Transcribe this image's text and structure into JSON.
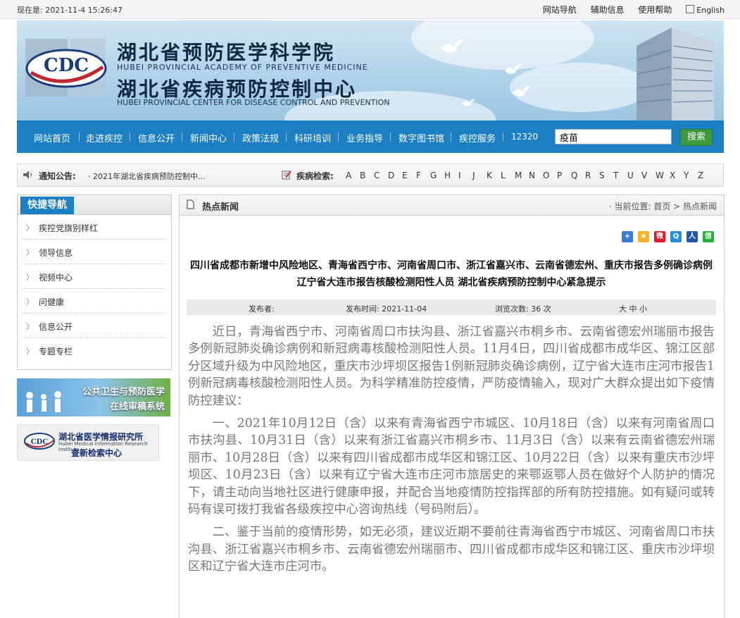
{
  "topbar": {
    "time": "现在是: 2021-11-4 15:26:47",
    "links": [
      "网站导航",
      "辅助信息",
      "使用帮助"
    ],
    "english": "English"
  },
  "banner": {
    "title_line1": "湖北省预防医学科学院",
    "subtitle_line1": "HUBEI PROVINCIAL ACADEMY OF PREVENTIVE MEDICINE",
    "title_line2": "湖北省疾病预防控制中心",
    "subtitle_line2": "HUBEI PROVINCIAL CENTER FOR DISEASE CONTROL AND PREVENTION",
    "logo_text": "CDC"
  },
  "nav": {
    "items": [
      "网站首页",
      "走进疾控",
      "信息公开",
      "新闻中心",
      "政策法规",
      "科研培训",
      "业务指导",
      "数字图书馆",
      "疾控服务",
      "12320"
    ],
    "search_value": "疫苗",
    "search_button": "搜索"
  },
  "notice": {
    "label": "通知公告:",
    "text": "· 2021年湖北省疾病预防控制中...",
    "disease_label": "疾病检索:",
    "letters": [
      "A",
      "B",
      "C",
      "D",
      "E",
      "F",
      "G",
      "H",
      "I",
      "J",
      "K",
      "L",
      "M",
      "N",
      "O",
      "P",
      "Q",
      "R",
      "S",
      "T",
      "U",
      "V",
      "W",
      "X",
      "Y",
      "Z"
    ]
  },
  "sidebar": {
    "title": "快捷导航",
    "items": [
      "疾控党旗别样红",
      "领导信息",
      "视频中心",
      "问健康",
      "信息公开",
      "专题专栏"
    ]
  },
  "promo1": {
    "line1": "公共卫生与预防医学",
    "line2": "在线审稿系统"
  },
  "promo2": {
    "line1": "湖北省医学情报研究所",
    "small": "Hubei Medical Information Research Institute",
    "line2": "查新检索中心"
  },
  "content": {
    "section_title": "热点新闻",
    "breadcrumb": "· 当前位置: 首页 > 热点新闻",
    "article_title": "四川省成都市新增中风险地区、青海省西宁市、河南省周口市、浙江省嘉兴市、云南省德宏州、重庆市报告多例确诊病例  辽宁省大连市报告核酸检测阳性人员  湖北省疾病预防控制中心紧急提示",
    "meta": {
      "publisher": "发布者:",
      "date": "发布时间: 2021-11-04",
      "views": "浏览次数: 36 次",
      "size": "大 中 小"
    },
    "paragraphs": [
      "近日，青海省西宁市、河南省周口市扶沟县、浙江省嘉兴市桐乡市、云南省德宏州瑞丽市报告多例新冠肺炎确诊病例和新冠病毒核酸检测阳性人员。11月4日，四川省成都市成华区、锦江区部分区域升级为中风险地区，重庆市沙坪坝区报告1例新冠肺炎确诊病例，辽宁省大连市庄河市报告1例新冠病毒核酸检测阳性人员。为科学精准防控疫情，严防疫情输入，现对广大群众提出如下疫情防控建议：",
      "一、2021年10月12日（含）以来有青海省西宁市城区、10月18日（含）以来有河南省周口市扶沟县、10月31日（含）以来有浙江省嘉兴市桐乡市、11月3日（含）以来有云南省德宏州瑞丽市、10月28日（含）以来有四川省成都市成华区和锦江区、10月22日（含）以来有重庆市沙坪坝区、10月23日（含）以来有辽宁省大连市庄河市旅居史的来鄂返鄂人员在做好个人防护的情况下，请主动向当地社区进行健康申报，并配合当地疫情防控指挥部的所有防控措施。如有疑问或转码有误可拨打我省各级疾控中心咨询热线（号码附后）。",
      "二、鉴于当前的疫情形势，如无必须，建议近期不要前往青海省西宁市城区、河南省周口市扶沟县、浙江省嘉兴市桐乡市、云南省德宏州瑞丽市、四川省成都市成华区和锦江区、重庆市沙坪坝区和辽宁省大连市庄河市。"
    ]
  },
  "colors": {
    "nav_blue": "#1b7fc3",
    "search_green": "#3c9a3c"
  }
}
